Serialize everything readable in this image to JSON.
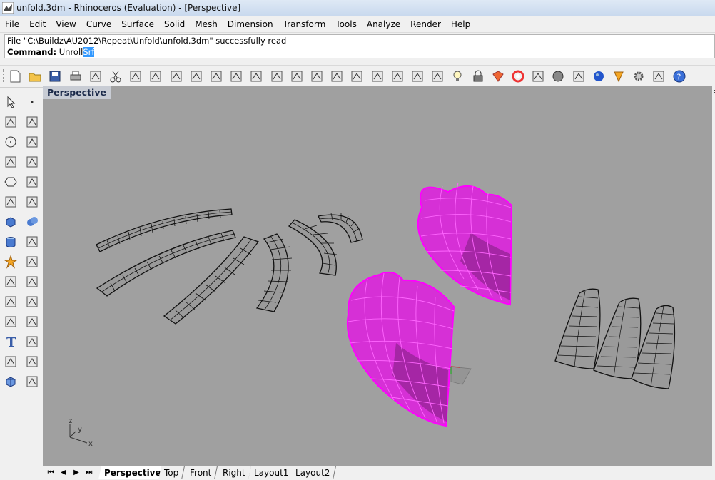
{
  "window": {
    "title": "unfold.3dm - Rhinoceros (Evaluation) - [Perspective]"
  },
  "menu": [
    "File",
    "Edit",
    "View",
    "Curve",
    "Surface",
    "Solid",
    "Mesh",
    "Dimension",
    "Transform",
    "Tools",
    "Analyze",
    "Render",
    "Help"
  ],
  "command": {
    "history": "File \"C:\\Buildz\\AU2012\\Repeat\\Unfold\\unfold.3dm\" successfully read",
    "label": "Command:",
    "typed": "Unroll",
    "suggestion": "Srf"
  },
  "toolbar_icons": [
    "new-file-icon",
    "open-folder-icon",
    "save-icon",
    "print-icon",
    "import-icon",
    "cut-icon",
    "copy-icon",
    "paste-icon",
    "undo-icon",
    "pan-hand-icon",
    "rotate-view-icon",
    "zoom-icon",
    "zoom-window-icon",
    "zoom-extents-icon",
    "zoom-selected-icon",
    "undo-view-icon",
    "four-viewports-icon",
    "car-render-icon",
    "car-wire-icon",
    "construction-plane-icon",
    "point-on-icon",
    "gumball-icon",
    "light-icon",
    "lock-icon",
    "material-icon",
    "color-wheel-icon",
    "wireframe-sphere-icon",
    "rendered-sphere-icon",
    "display-mode-sphere-icon",
    "blue-sphere-icon",
    "snap-icon",
    "options-gear-icon",
    "grid-snap-icon",
    "help-icon"
  ],
  "sidebar_icons": [
    [
      "select-arrow-icon",
      "point-icon"
    ],
    [
      "polyline-icon",
      "curve-icon"
    ],
    [
      "circle-icon",
      "arc-icon"
    ],
    [
      "polygon-icon",
      "rectangle-icon"
    ],
    [
      "hexagon-icon",
      "fillet-curve-icon"
    ],
    [
      "surface-corner-icon",
      "loft-icon"
    ],
    [
      "box-icon",
      "boolean-union-icon"
    ],
    [
      "cylinder-icon",
      "extrude-surface-icon"
    ],
    [
      "explode-icon",
      "split-icon"
    ],
    [
      "trim-icon",
      "align-icon"
    ],
    [
      "group-icon",
      "array-icon"
    ],
    [
      "move-icon",
      "scale-icon"
    ],
    [
      "text-icon",
      "dimension-icon"
    ],
    [
      "block-icon",
      "sweep-icon"
    ],
    [
      "mesh-box-icon",
      "hatch-icon"
    ]
  ],
  "viewport": {
    "label": "Perspective",
    "axes": {
      "x": "x",
      "y": "y",
      "z": "z"
    }
  },
  "right_strip": {
    "text": "P"
  },
  "tabs": [
    "Perspective",
    "Top",
    "Front",
    "Right",
    "Layout1",
    "Layout2"
  ],
  "active_tab": "Perspective",
  "colors": {
    "viewport_bg": "#a0a0a0",
    "selected": "#ff00ff",
    "grid_surface": "#444444"
  }
}
